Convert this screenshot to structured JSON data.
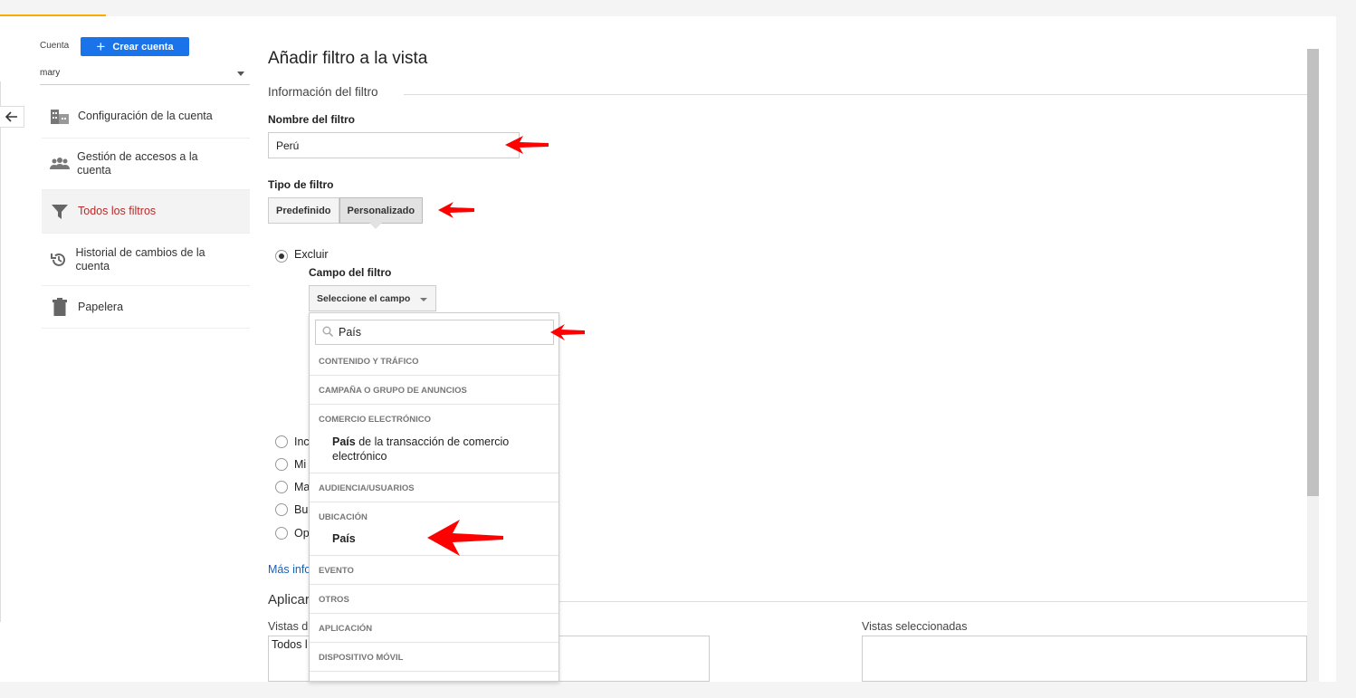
{
  "sidebar": {
    "account_label": "Cuenta",
    "create_account_label": "Crear cuenta",
    "account_value": "mary",
    "items": [
      {
        "label": "Configuración de la cuenta",
        "icon": "building-icon"
      },
      {
        "label": "Gestión de accesos a la cuenta",
        "icon": "people-icon"
      },
      {
        "label": "Todos los filtros",
        "icon": "filter-icon",
        "active": true
      },
      {
        "label": "Historial de cambios de la cuenta",
        "icon": "history-icon"
      },
      {
        "label": "Papelera",
        "icon": "trash-icon"
      }
    ]
  },
  "main": {
    "title": "Añadir filtro a la vista",
    "section_info": "Información del filtro",
    "filter_name_label": "Nombre del filtro",
    "filter_name_value": "Perú",
    "filter_type_label": "Tipo de filtro",
    "filter_type_options": [
      "Predefinido",
      "Personalizado"
    ],
    "filter_type_selected": "Personalizado",
    "radios": [
      {
        "label": "Excluir",
        "checked": true
      },
      {
        "label": "Inc",
        "checked": false
      },
      {
        "label": "Mi",
        "checked": false
      },
      {
        "label": "Ma",
        "checked": false
      },
      {
        "label": "Bu",
        "checked": false
      },
      {
        "label": "Op",
        "checked": false
      }
    ],
    "filter_field_label": "Campo del filtro",
    "filter_field_select": "Seleccione el campo",
    "more_info": "Más info",
    "apply_title": "Aplicar",
    "available_views_label": "Vistas d",
    "available_views_item": "Todos l",
    "selected_views_label": "Vistas seleccionadas"
  },
  "dropdown": {
    "search_value": "País",
    "groups": [
      {
        "title": "CONTENIDO Y TRÁFICO",
        "items": []
      },
      {
        "title": "CAMPAÑA O GRUPO DE ANUNCIOS",
        "items": []
      },
      {
        "title": "COMERCIO ELECTRÓNICO",
        "items": [
          {
            "bold": "País",
            "rest": " de la transacción de comercio electrónico"
          }
        ]
      },
      {
        "title": "AUDIENCIA/USUARIOS",
        "items": []
      },
      {
        "title": "UBICACIÓN",
        "items": [
          {
            "bold": "País",
            "rest": ""
          }
        ]
      },
      {
        "title": "EVENTO",
        "items": []
      },
      {
        "title": "OTROS",
        "items": []
      },
      {
        "title": "APLICACIÓN",
        "items": []
      },
      {
        "title": "DISPOSITIVO MÓVIL",
        "items": []
      }
    ]
  },
  "colors": {
    "accent_blue": "#1a73e8",
    "active_red": "#b72a2a",
    "annotation_red": "#ff0000",
    "tab_underline": "#f9ab00"
  }
}
